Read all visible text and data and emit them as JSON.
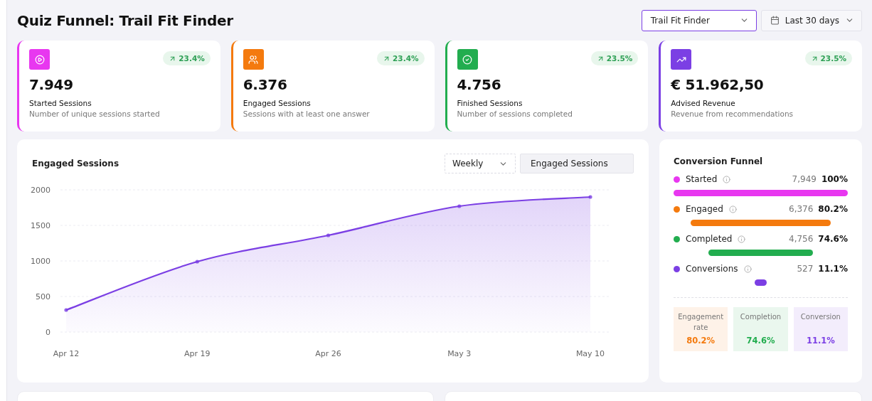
{
  "header": {
    "title": "Quiz Funnel: Trail Fit Finder",
    "quiz_select": {
      "value": "Trail Fit Finder"
    },
    "date_select": {
      "value": "Last 30 days"
    }
  },
  "stat_cards": [
    {
      "kind": "play",
      "color": "#e837f0",
      "value": "7.949",
      "label": "Started Sessions",
      "description": "Number of unique sessions started",
      "change": "23.4%"
    },
    {
      "kind": "users",
      "color": "#f47a0e",
      "value": "6.376",
      "label": "Engaged Sessions",
      "description": "Sessions with at least one answer",
      "change": "23.4%"
    },
    {
      "kind": "check",
      "color": "#22ad4f",
      "value": "4.756",
      "label": "Finished Sessions",
      "description": "Number of sessions completed",
      "change": "23.5%"
    },
    {
      "kind": "trend",
      "color": "#7b3fe4",
      "value": "€ 51.962,50",
      "label": "Advised Revenue",
      "description": "Revenue from recommendations",
      "change": "23.5%"
    }
  ],
  "sessions_panel": {
    "title": "Engaged Sessions",
    "interval_select": {
      "value": "Weekly"
    },
    "chart_data": {
      "type": "area",
      "grid": true,
      "categories": [
        "Apr 12",
        "Apr 19",
        "Apr 26",
        "May 3",
        "May 10"
      ],
      "series": [
        {
          "name": "Engaged Sessions",
          "color": "#7b3fe4",
          "values": [
            310,
            990,
            1360,
            1770,
            1900
          ]
        }
      ],
      "ylim": [
        0,
        2000
      ],
      "yticks": [
        0,
        500,
        1000,
        1500,
        2000
      ]
    }
  },
  "funnel": {
    "title": "Conversion Funnel",
    "stages": [
      {
        "name": "Started",
        "color": "#e837f0",
        "count": "7,949",
        "percent": "100%"
      },
      {
        "name": "Engaged",
        "color": "#f47a0e",
        "count": "6,376",
        "percent": "80.2%"
      },
      {
        "name": "Completed",
        "color": "#22ad4f",
        "count": "4,756",
        "percent": "74.6%"
      },
      {
        "name": "Conversions",
        "color": "#7b3fe4",
        "count": "527",
        "percent": "11.1%"
      }
    ],
    "rates": [
      {
        "label": "Engagement rate",
        "value": "80.2%",
        "color": "#f47a0e"
      },
      {
        "label": "Completion",
        "value": "74.6%",
        "color": "#22ad4f"
      },
      {
        "label": "Conversion",
        "value": "11.1%",
        "color": "#7b3fe4"
      }
    ]
  }
}
